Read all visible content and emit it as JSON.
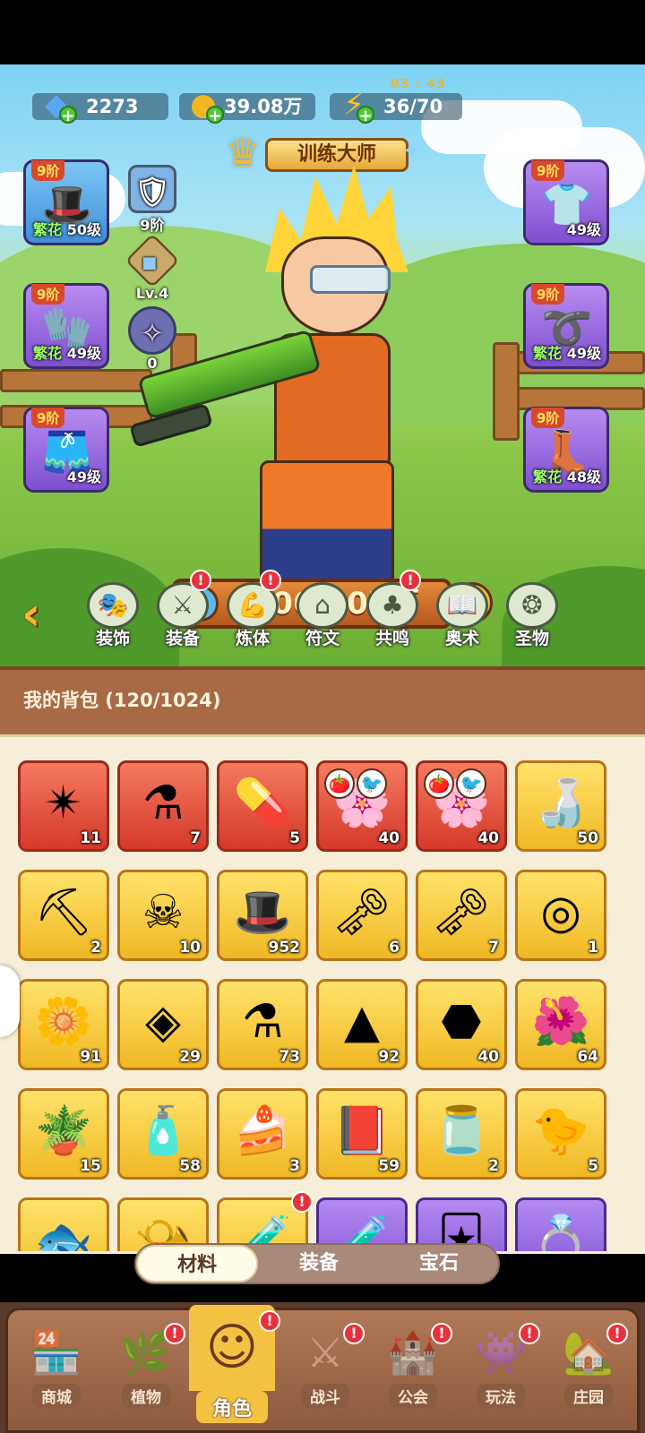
{
  "resources": {
    "gems": "2273",
    "gold": "39.08万",
    "energy": "36/70",
    "energy_timer": "03 : 43"
  },
  "title": "训练大师",
  "equipment_left": [
    {
      "tier": "9阶",
      "level": "50级",
      "tag": "繁花",
      "icon": "hat-icon",
      "color": "blue"
    },
    {
      "tier": "9阶",
      "level": "49级",
      "tag": "繁花",
      "icon": "gloves-icon",
      "color": "purple"
    },
    {
      "tier": "9阶",
      "level": "49级",
      "tag": "",
      "icon": "shorts-icon",
      "color": "purple"
    }
  ],
  "equipment_right": [
    {
      "tier": "9阶",
      "level": "49级",
      "tag": "",
      "icon": "shirt-icon",
      "color": "purple"
    },
    {
      "tier": "9阶",
      "level": "49级",
      "tag": "繁花",
      "icon": "belt-icon",
      "color": "purple"
    },
    {
      "tier": "9阶",
      "level": "48级",
      "tag": "繁花",
      "icon": "boots-icon",
      "color": "purple"
    }
  ],
  "side_stats": [
    {
      "icon": "badge-icon",
      "value": "9阶"
    },
    {
      "icon": "crystal-icon",
      "value": "Lv.4"
    },
    {
      "icon": "orbit-icon",
      "value": "0"
    }
  ],
  "power": "1061.07万",
  "menu": [
    {
      "label": "装饰",
      "badge": false
    },
    {
      "label": "装备",
      "badge": true
    },
    {
      "label": "炼体",
      "badge": true
    },
    {
      "label": "符文",
      "badge": false
    },
    {
      "label": "共鸣",
      "badge": true
    },
    {
      "label": "奥术",
      "badge": false
    },
    {
      "label": "圣物",
      "badge": false
    }
  ],
  "bag": {
    "title": "我的背包 (120/1024)",
    "items": [
      {
        "icon": "star-crystal-icon",
        "count": "11",
        "rarity": "red"
      },
      {
        "icon": "potion-icon",
        "count": "7",
        "rarity": "red"
      },
      {
        "icon": "capsule-icon",
        "count": "5",
        "rarity": "red"
      },
      {
        "icon": "flower-bud-icon",
        "count": "40",
        "rarity": "red"
      },
      {
        "icon": "flower-bud-icon",
        "count": "40",
        "rarity": "red"
      },
      {
        "icon": "bottle-icon",
        "count": "50",
        "rarity": "gold"
      },
      {
        "icon": "pickaxe-icon",
        "count": "2",
        "rarity": "gold"
      },
      {
        "icon": "skull-scroll-icon",
        "count": "10",
        "rarity": "gold"
      },
      {
        "icon": "magic-hat-icon",
        "count": "952",
        "rarity": "gold"
      },
      {
        "icon": "red-key-icon",
        "count": "6",
        "rarity": "gold"
      },
      {
        "icon": "green-key-icon",
        "count": "7",
        "rarity": "gold"
      },
      {
        "icon": "golden-orb-icon",
        "count": "1",
        "rarity": "gold"
      },
      {
        "icon": "golden-flower-icon",
        "count": "91",
        "rarity": "gold"
      },
      {
        "icon": "rune-stone-icon",
        "count": "29",
        "rarity": "gold"
      },
      {
        "icon": "orange-potion-icon",
        "count": "73",
        "rarity": "gold"
      },
      {
        "icon": "gold-pile-icon",
        "count": "92",
        "rarity": "gold"
      },
      {
        "icon": "ore-icon",
        "count": "40",
        "rarity": "gold"
      },
      {
        "icon": "red-flower-icon",
        "count": "64",
        "rarity": "gold"
      },
      {
        "icon": "flower-pot-icon",
        "count": "15",
        "rarity": "gold"
      },
      {
        "icon": "sprayer-icon",
        "count": "58",
        "rarity": "gold"
      },
      {
        "icon": "cake-icon",
        "count": "3",
        "rarity": "gold"
      },
      {
        "icon": "book-icon",
        "count": "59",
        "rarity": "gold"
      },
      {
        "icon": "jar-icon",
        "count": "2",
        "rarity": "gold"
      },
      {
        "icon": "pet-bird-icon",
        "count": "5",
        "rarity": "gold"
      },
      {
        "icon": "fish-icon",
        "count": "",
        "rarity": "gold"
      },
      {
        "icon": "horn-icon",
        "count": "",
        "rarity": "gold"
      },
      {
        "icon": "green-potion-icon",
        "count": "",
        "rarity": "gold"
      },
      {
        "icon": "purple-potion-icon",
        "count": "",
        "rarity": "purple"
      },
      {
        "icon": "card-icon",
        "count": "",
        "rarity": "purple"
      },
      {
        "icon": "ring-icon",
        "count": "",
        "rarity": "purple"
      }
    ]
  },
  "tabs": [
    {
      "label": "材料",
      "active": true
    },
    {
      "label": "装备",
      "active": false
    },
    {
      "label": "宝石",
      "active": false
    }
  ],
  "bottom_nav": [
    {
      "label": "商城",
      "active": false,
      "badge": false
    },
    {
      "label": "植物",
      "active": false,
      "badge": true
    },
    {
      "label": "角色",
      "active": true,
      "badge": true
    },
    {
      "label": "战斗",
      "active": false,
      "badge": true
    },
    {
      "label": "公会",
      "active": false,
      "badge": true
    },
    {
      "label": "玩法",
      "active": false,
      "badge": true
    },
    {
      "label": "庄园",
      "active": false,
      "badge": true
    }
  ],
  "icons": {
    "help": "?",
    "back": "‹",
    "badge": "!"
  }
}
